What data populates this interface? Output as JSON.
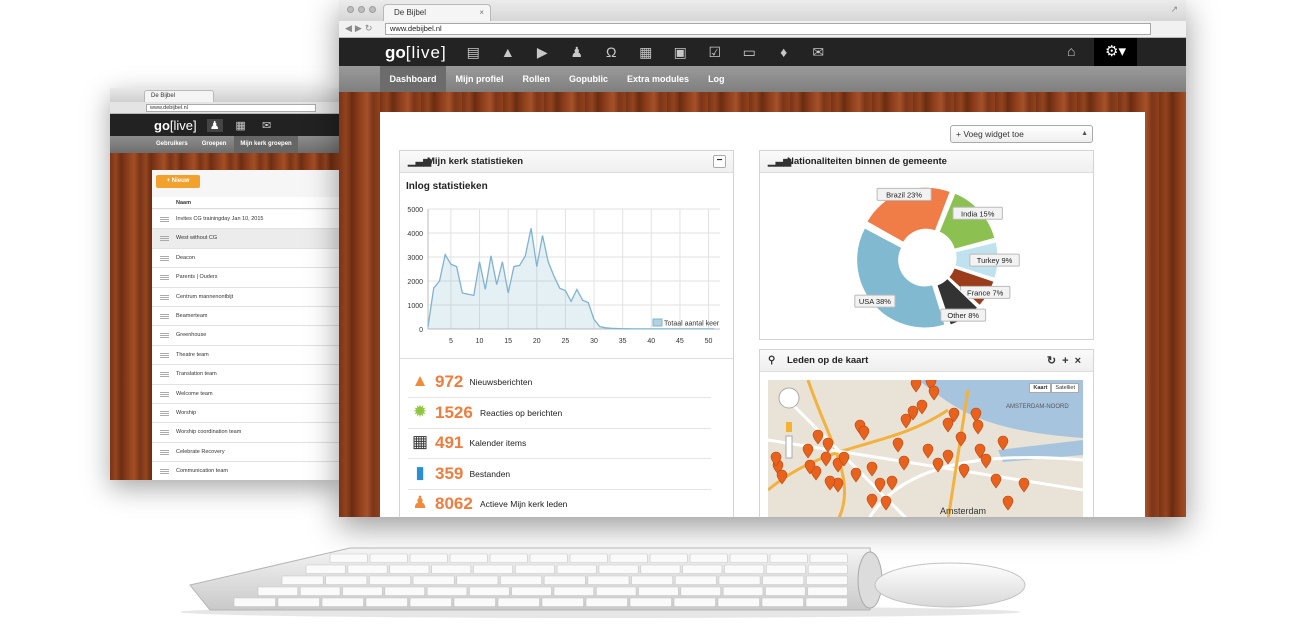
{
  "back_window": {
    "tab_title": "De Bijbel",
    "url": "www.debijbel.nl",
    "logo": {
      "bold": "go",
      "rest": "[live]"
    },
    "nav_icons": [
      "user-icon",
      "calendar-icon",
      "mail-icon"
    ],
    "subnav": [
      "Gebruikers",
      "Groepen",
      "Mijn kerk groepen"
    ],
    "new_button": "+ Nieuw",
    "column_header": "Naam",
    "groups": [
      "Invites CG trainingday Jan 10, 2015",
      "West without CG",
      "Deacon",
      "Parents | Ouders",
      "Centrum mannenontbijt",
      "Beamerteam",
      "Greenhouse",
      "Theatre team",
      "Translation team",
      "Welcome team",
      "Worship",
      "Worship coordination team",
      "Celebrate Recovery",
      "Communication team"
    ]
  },
  "front_window": {
    "tab_title": "De Bijbel",
    "url": "www.debijbel.nl",
    "logo": {
      "bold": "go",
      "rest": "[live]"
    },
    "nav_icons": [
      "book-icon",
      "megaphone-icon",
      "video-icon",
      "user-icon",
      "headphones-icon",
      "calendar-icon",
      "picture-icon",
      "checkbox-icon",
      "inbox-icon",
      "graduation-cap-icon",
      "mail-icon"
    ],
    "subnav": [
      "Dashboard",
      "Mijn profiel",
      "Rollen",
      "Gopublic",
      "Extra modules",
      "Log"
    ],
    "widget_select": "+ Voeg widget toe"
  },
  "stats_widget": {
    "title": "Mijn kerk statistieken",
    "chart_title": "Inlog statistieken",
    "items": [
      {
        "value": "972",
        "label": "Nieuwsberichten",
        "icon": "megaphone-icon",
        "color": "#f08a3c"
      },
      {
        "value": "1526",
        "label": "Reacties op berichten",
        "icon": "badge-icon",
        "color": "#8dc63f"
      },
      {
        "value": "491",
        "label": "Kalender items",
        "icon": "calendar-icon",
        "color": "#333333"
      },
      {
        "value": "359",
        "label": "Bestanden",
        "icon": "book-icon",
        "color": "#2a8fd0"
      },
      {
        "value": "8062",
        "label": "Actieve Mijn kerk leden",
        "icon": "user-icon",
        "color": "#f08a3c"
      }
    ]
  },
  "pie_widget": {
    "title": "Nationaliteiten binnen de gemeente"
  },
  "map_widget": {
    "title": "Leden op de kaart",
    "map_buttons": [
      "Kaart",
      "Satelliet"
    ],
    "labels": [
      "AMSTERDAM-NOORD",
      "Amsterdam"
    ]
  },
  "chart_data": [
    {
      "type": "area",
      "title": "Inlog statistieken",
      "series": [
        {
          "name": "Totaal aantal keer",
          "x": [
            1,
            2,
            3,
            4,
            5,
            6,
            7,
            8,
            9,
            10,
            11,
            12,
            13,
            14,
            15,
            16,
            17,
            18,
            19,
            20,
            21,
            22,
            23,
            24,
            25,
            26,
            27,
            28,
            29,
            30,
            31,
            32,
            33,
            34,
            35,
            36,
            37,
            38,
            39,
            40,
            41,
            42,
            43,
            44,
            45,
            46,
            47,
            48,
            49,
            50,
            51
          ],
          "values": [
            100,
            1700,
            2000,
            3100,
            2700,
            2600,
            1500,
            1450,
            1400,
            2800,
            1650,
            3050,
            1850,
            2800,
            1500,
            2600,
            2650,
            3050,
            4200,
            2600,
            3900,
            2800,
            2200,
            1700,
            1600,
            1150,
            1650,
            1200,
            1100,
            400,
            100,
            50,
            30,
            20,
            10,
            10,
            5,
            5,
            5,
            5,
            5,
            5,
            5,
            5,
            5,
            5,
            5,
            5,
            5,
            5,
            5
          ],
          "color": "#7fb3cf"
        }
      ],
      "xticks": [
        5,
        10,
        15,
        20,
        25,
        30,
        35,
        40,
        45,
        50
      ],
      "yticks": [
        0,
        1000,
        2000,
        3000,
        4000,
        5000
      ],
      "xlim": [
        1,
        52
      ],
      "ylim": [
        0,
        5000
      ],
      "legend": "bottom-right",
      "grid": true
    },
    {
      "type": "pie",
      "slices": [
        {
          "label": "USA 38%",
          "value": 38,
          "color": "#80b9d0"
        },
        {
          "label": "Brazil 23%",
          "value": 23,
          "color": "#f07c48"
        },
        {
          "label": "India 15%",
          "value": 15,
          "color": "#8cc152"
        },
        {
          "label": "Turkey 9%",
          "value": 9,
          "color": "#bfe2ee"
        },
        {
          "label": "France 7%",
          "value": 7,
          "color": "#9b3d1a"
        },
        {
          "label": "Other 8%",
          "value": 8,
          "color": "#333333"
        }
      ],
      "donut": true
    }
  ]
}
